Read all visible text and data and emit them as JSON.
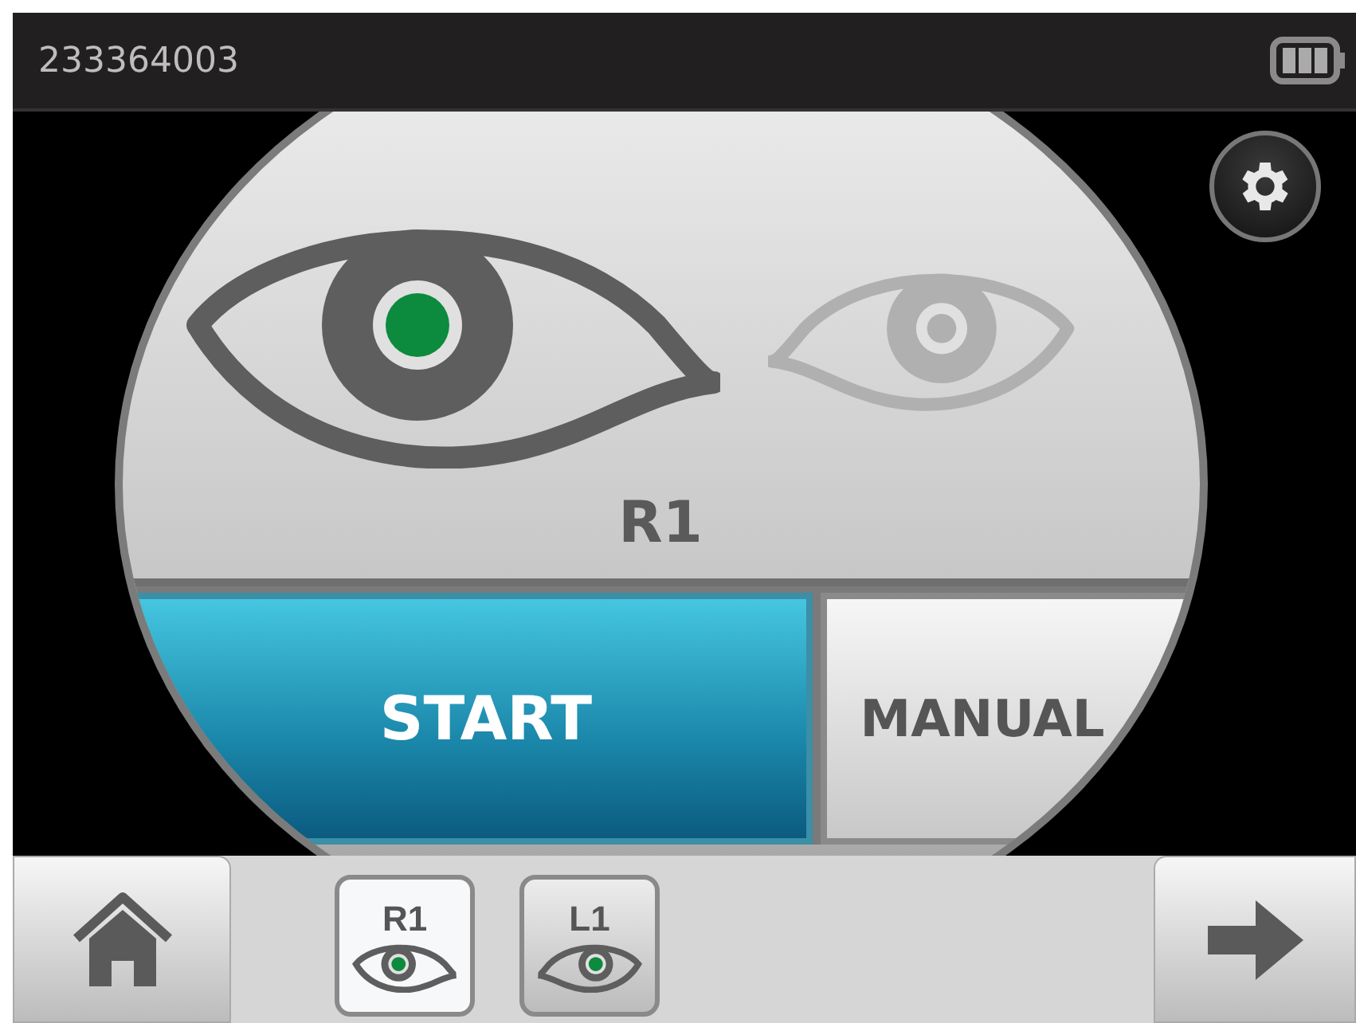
{
  "status_bar": {
    "serial": "233364003"
  },
  "eye_view": {
    "eyes": [
      {
        "kind": "right",
        "selected": true
      },
      {
        "kind": "left",
        "selected": false
      }
    ],
    "label": "R1"
  },
  "actions": [
    {
      "label": "START",
      "kind": "primary"
    },
    {
      "label": "MANUAL",
      "kind": "secondary"
    }
  ],
  "eye_tabs": [
    {
      "label": "R1",
      "kind": "right",
      "selected": true
    },
    {
      "label": "L1",
      "kind": "left",
      "selected": false
    }
  ]
}
